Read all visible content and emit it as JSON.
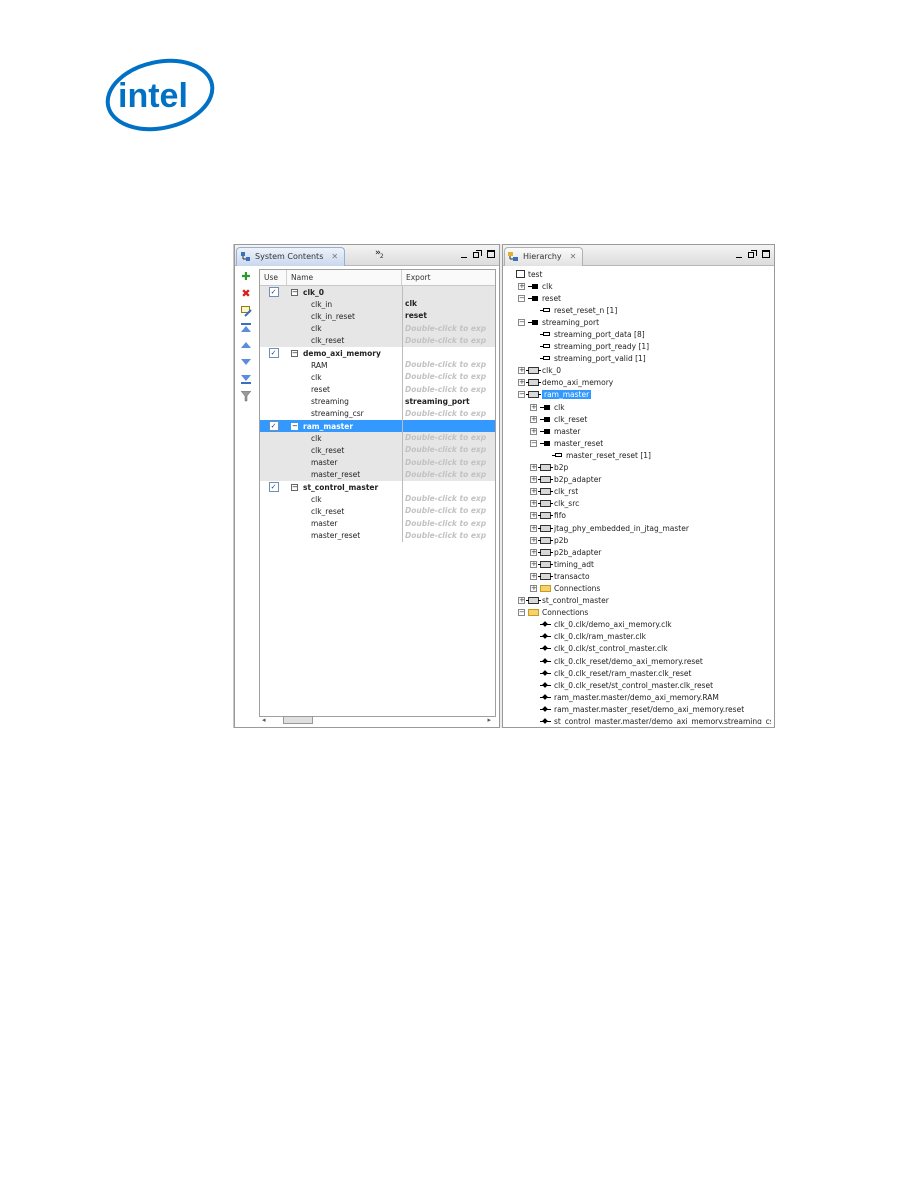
{
  "brand": {
    "logo_text": "intel",
    "logo_color": "#0071c5"
  },
  "left_view": {
    "tab_title": "System Contents",
    "overflow_label": "»",
    "overflow_count": "2",
    "toolbar_icons": [
      "add-icon",
      "remove-icon",
      "edit-icon",
      "move-top-icon",
      "move-up-icon",
      "move-down-icon",
      "move-bottom-icon",
      "filter-icon"
    ],
    "columns": {
      "use": "Use",
      "name": "Name",
      "export": "Export"
    },
    "rows": [
      {
        "kind": "module",
        "name": "clk_0",
        "checked": true,
        "shaded": true,
        "export": ""
      },
      {
        "kind": "iface",
        "name": "clk_in",
        "shaded": true,
        "export": "clk",
        "hint": false
      },
      {
        "kind": "iface",
        "name": "clk_in_reset",
        "shaded": true,
        "export": "reset",
        "hint": false
      },
      {
        "kind": "iface",
        "name": "clk",
        "shaded": true,
        "export": "Double-click to exp",
        "hint": true
      },
      {
        "kind": "iface",
        "name": "clk_reset",
        "shaded": true,
        "export": "Double-click to exp",
        "hint": true
      },
      {
        "kind": "module",
        "name": "demo_axi_memory",
        "checked": true,
        "shaded": false,
        "export": ""
      },
      {
        "kind": "iface",
        "name": "RAM",
        "shaded": false,
        "export": "Double-click to exp",
        "hint": true
      },
      {
        "kind": "iface",
        "name": "clk",
        "shaded": false,
        "export": "Double-click to exp",
        "hint": true
      },
      {
        "kind": "iface",
        "name": "reset",
        "shaded": false,
        "export": "Double-click to exp",
        "hint": true
      },
      {
        "kind": "iface",
        "name": "streaming",
        "shaded": false,
        "export": "streaming_port",
        "hint": false
      },
      {
        "kind": "iface",
        "name": "streaming_csr",
        "shaded": false,
        "export": "Double-click to exp",
        "hint": true
      },
      {
        "kind": "module",
        "name": "ram_master",
        "checked": true,
        "shaded": false,
        "selected": true,
        "export": ""
      },
      {
        "kind": "iface",
        "name": "clk",
        "shaded": true,
        "export": "Double-click to exp",
        "hint": true
      },
      {
        "kind": "iface",
        "name": "clk_reset",
        "shaded": true,
        "export": "Double-click to exp",
        "hint": true
      },
      {
        "kind": "iface",
        "name": "master",
        "shaded": true,
        "export": "Double-click to exp",
        "hint": true
      },
      {
        "kind": "iface",
        "name": "master_reset",
        "shaded": true,
        "export": "Double-click to exp",
        "hint": true
      },
      {
        "kind": "module",
        "name": "st_control_master",
        "checked": true,
        "shaded": false,
        "export": ""
      },
      {
        "kind": "iface",
        "name": "clk",
        "shaded": false,
        "export": "Double-click to exp",
        "hint": true
      },
      {
        "kind": "iface",
        "name": "clk_reset",
        "shaded": false,
        "export": "Double-click to exp",
        "hint": true
      },
      {
        "kind": "iface",
        "name": "master",
        "shaded": false,
        "export": "Double-click to exp",
        "hint": true
      },
      {
        "kind": "iface",
        "name": "master_reset",
        "shaded": false,
        "export": "Double-click to exp",
        "hint": true
      }
    ]
  },
  "right_view": {
    "tab_title": "Hierarchy",
    "tree": [
      {
        "depth": 0,
        "toggle": "",
        "icon": "root",
        "label": "test"
      },
      {
        "depth": 1,
        "toggle": "+",
        "icon": "clk",
        "label": "clk"
      },
      {
        "depth": 1,
        "toggle": "-",
        "icon": "clk",
        "label": "reset"
      },
      {
        "depth": 2,
        "toggle": "",
        "icon": "sig",
        "label": "reset_reset_n [1]"
      },
      {
        "depth": 1,
        "toggle": "-",
        "icon": "clk",
        "label": "streaming_port"
      },
      {
        "depth": 2,
        "toggle": "",
        "icon": "sig",
        "label": "streaming_port_data [8]"
      },
      {
        "depth": 2,
        "toggle": "",
        "icon": "sig",
        "label": "streaming_port_ready [1]"
      },
      {
        "depth": 2,
        "toggle": "",
        "icon": "sig",
        "label": "streaming_port_valid [1]"
      },
      {
        "depth": 1,
        "toggle": "+",
        "icon": "mod",
        "label": "clk_0"
      },
      {
        "depth": 1,
        "toggle": "+",
        "icon": "mod",
        "label": "demo_axi_memory"
      },
      {
        "depth": 1,
        "toggle": "-",
        "icon": "mod",
        "label": "ram_master",
        "selected": true
      },
      {
        "depth": 2,
        "toggle": "+",
        "icon": "clk",
        "label": "clk"
      },
      {
        "depth": 2,
        "toggle": "+",
        "icon": "clk",
        "label": "clk_reset"
      },
      {
        "depth": 2,
        "toggle": "+",
        "icon": "clk",
        "label": "master"
      },
      {
        "depth": 2,
        "toggle": "-",
        "icon": "clk",
        "label": "master_reset"
      },
      {
        "depth": 3,
        "toggle": "",
        "icon": "sig",
        "label": "master_reset_reset [1]"
      },
      {
        "depth": 2,
        "toggle": "+",
        "icon": "mod",
        "label": "b2p"
      },
      {
        "depth": 2,
        "toggle": "+",
        "icon": "mod",
        "label": "b2p_adapter"
      },
      {
        "depth": 2,
        "toggle": "+",
        "icon": "mod",
        "label": "clk_rst"
      },
      {
        "depth": 2,
        "toggle": "+",
        "icon": "mod",
        "label": "clk_src"
      },
      {
        "depth": 2,
        "toggle": "+",
        "icon": "mod",
        "label": "fifo"
      },
      {
        "depth": 2,
        "toggle": "+",
        "icon": "mod",
        "label": "jtag_phy_embedded_in_jtag_master"
      },
      {
        "depth": 2,
        "toggle": "+",
        "icon": "mod",
        "label": "p2b"
      },
      {
        "depth": 2,
        "toggle": "+",
        "icon": "mod",
        "label": "p2b_adapter"
      },
      {
        "depth": 2,
        "toggle": "+",
        "icon": "mod",
        "label": "timing_adt"
      },
      {
        "depth": 2,
        "toggle": "+",
        "icon": "mod",
        "label": "transacto"
      },
      {
        "depth": 2,
        "toggle": "+",
        "icon": "folder",
        "label": "Connections"
      },
      {
        "depth": 1,
        "toggle": "+",
        "icon": "mod",
        "label": "st_control_master"
      },
      {
        "depth": 1,
        "toggle": "-",
        "icon": "folder",
        "label": "Connections"
      },
      {
        "depth": 2,
        "toggle": "",
        "icon": "conn",
        "label": "clk_0.clk/demo_axi_memory.clk"
      },
      {
        "depth": 2,
        "toggle": "",
        "icon": "conn",
        "label": "clk_0.clk/ram_master.clk"
      },
      {
        "depth": 2,
        "toggle": "",
        "icon": "conn",
        "label": "clk_0.clk/st_control_master.clk"
      },
      {
        "depth": 2,
        "toggle": "",
        "icon": "conn",
        "label": "clk_0.clk_reset/demo_axi_memory.reset"
      },
      {
        "depth": 2,
        "toggle": "",
        "icon": "conn",
        "label": "clk_0.clk_reset/ram_master.clk_reset"
      },
      {
        "depth": 2,
        "toggle": "",
        "icon": "conn",
        "label": "clk_0.clk_reset/st_control_master.clk_reset"
      },
      {
        "depth": 2,
        "toggle": "",
        "icon": "conn",
        "label": "ram_master.master/demo_axi_memory.RAM"
      },
      {
        "depth": 2,
        "toggle": "",
        "icon": "conn",
        "label": "ram_master.master_reset/demo_axi_memory.reset"
      },
      {
        "depth": 2,
        "toggle": "",
        "icon": "conn",
        "label": "st_control_master.master/demo_axi_memory.streaming_csr"
      }
    ]
  }
}
